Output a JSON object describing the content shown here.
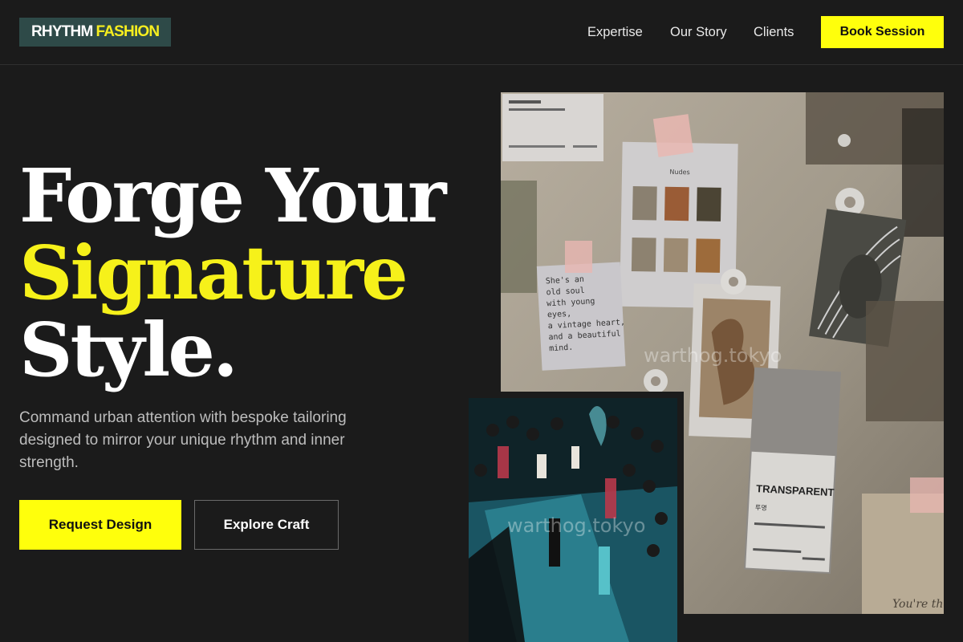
{
  "brand": {
    "word1": "RHYTHM",
    "word2": "FASHION"
  },
  "nav": {
    "links": [
      "Expertise",
      "Our Story",
      "Clients"
    ],
    "cta": "Book Session"
  },
  "hero": {
    "title_line1": "Forge Your",
    "title_line2": "Signature",
    "title_line3": "Style.",
    "subtitle": "Command urban attention with bespoke tailoring designed to mirror your unique rhythm and inner strength.",
    "primary_cta": "Request Design",
    "secondary_cta": "Explore Craft"
  },
  "moodboard": {
    "note_lines": [
      "She's an",
      "old soul",
      "with young",
      "eyes,",
      "a vintage heart,",
      "and a beautiful",
      "mind."
    ],
    "swatch_title": "Nudes",
    "card_title": "TRANSPARENT",
    "card_subtitle": "투명",
    "scribble": "You're the"
  },
  "watermark": "warthog.tokyo",
  "colors": {
    "background": "#1b1b1b",
    "accent": "#ffff0c",
    "logo_bg": "#2e4a48"
  }
}
